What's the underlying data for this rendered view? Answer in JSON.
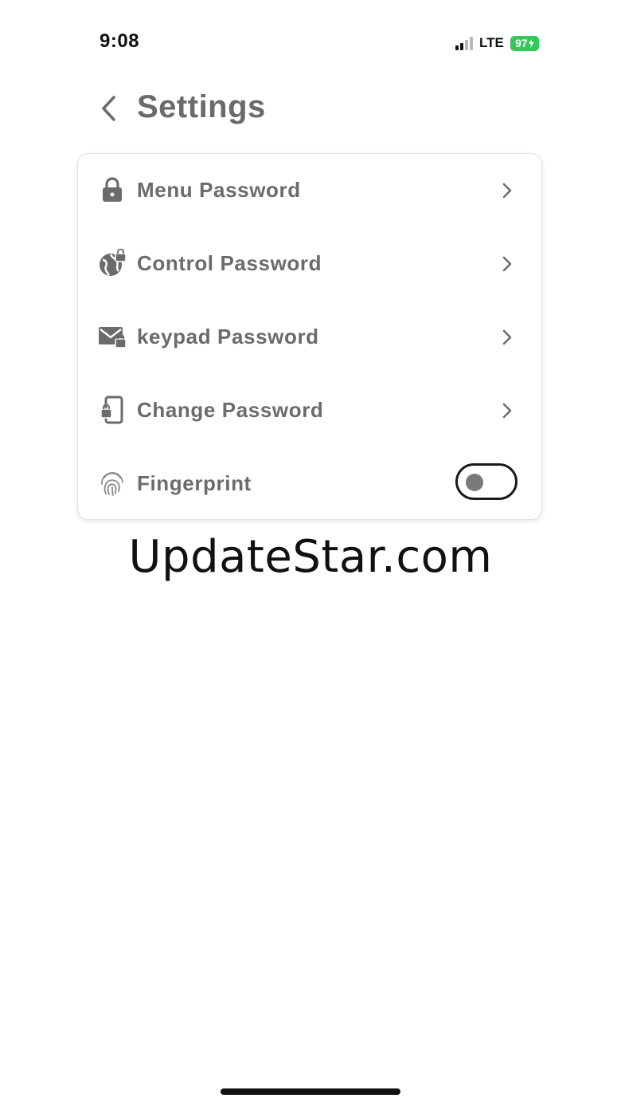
{
  "status_bar": {
    "time": "9:08",
    "network": "LTE",
    "battery": "97",
    "battery_color": "#34c759"
  },
  "header": {
    "back_icon": "chevron-left-icon",
    "title": "Settings"
  },
  "settings": {
    "items": [
      {
        "label": "Menu Password",
        "icon": "lock-icon",
        "control": "chevron"
      },
      {
        "label": "Control Password",
        "icon": "globe-lock-icon",
        "control": "chevron"
      },
      {
        "label": "keypad Password",
        "icon": "mail-lock-icon",
        "control": "chevron"
      },
      {
        "label": "Change Password",
        "icon": "phone-lock-icon",
        "control": "chevron"
      },
      {
        "label": "Fingerprint",
        "icon": "fingerprint-icon",
        "control": "toggle",
        "enabled": false
      }
    ]
  },
  "watermark": "UpdateStar.com"
}
